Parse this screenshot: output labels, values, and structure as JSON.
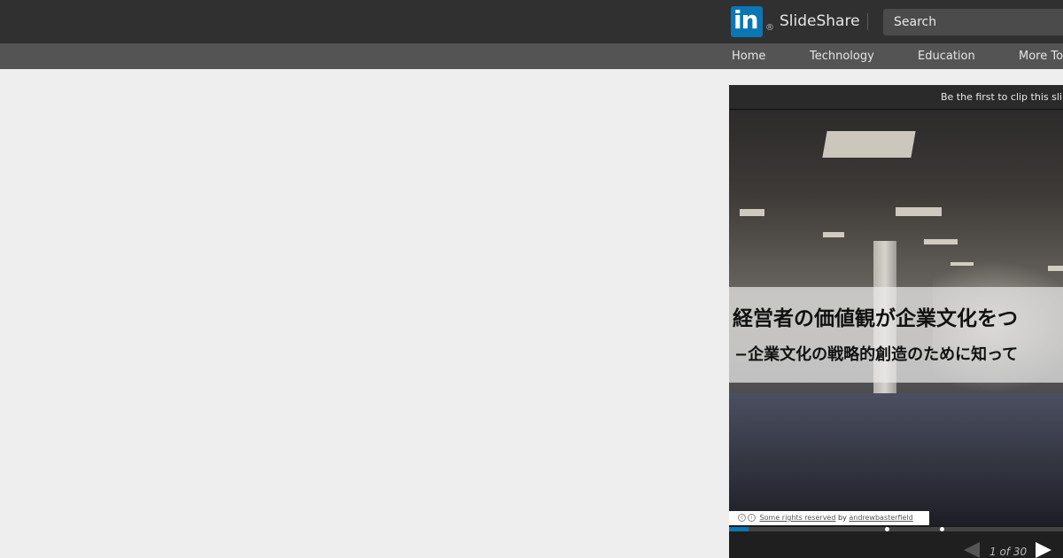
{
  "header": {
    "logo_text": "in",
    "registered_mark": "®",
    "brand": "SlideShare",
    "search": {
      "placeholder": "Search"
    },
    "colors": {
      "bar": "#303030",
      "accent": "#0a76b4"
    }
  },
  "nav": {
    "items": [
      {
        "label": "Home"
      },
      {
        "label": "Technology"
      },
      {
        "label": "Education"
      },
      {
        "label": "More To"
      }
    ]
  },
  "player": {
    "clip_prompt": "Be the first to clip this sli",
    "slide": {
      "title": "経営者の価値観が企業文化をつ",
      "subtitle": "−企業文化の戦略的創造のために知って",
      "credit": {
        "icons": [
          "creative-commons-icon",
          "attribution-icon"
        ],
        "rights": "Some rights reserved",
        "by": "by",
        "author": "andrewbasterfield"
      }
    },
    "progress": {
      "fraction": 0.054,
      "markers": [
        0.445,
        0.6
      ]
    },
    "page_indicator": "1 of 30",
    "icons": {
      "prev": "prev-arrow-icon",
      "next": "next-arrow-icon"
    }
  }
}
